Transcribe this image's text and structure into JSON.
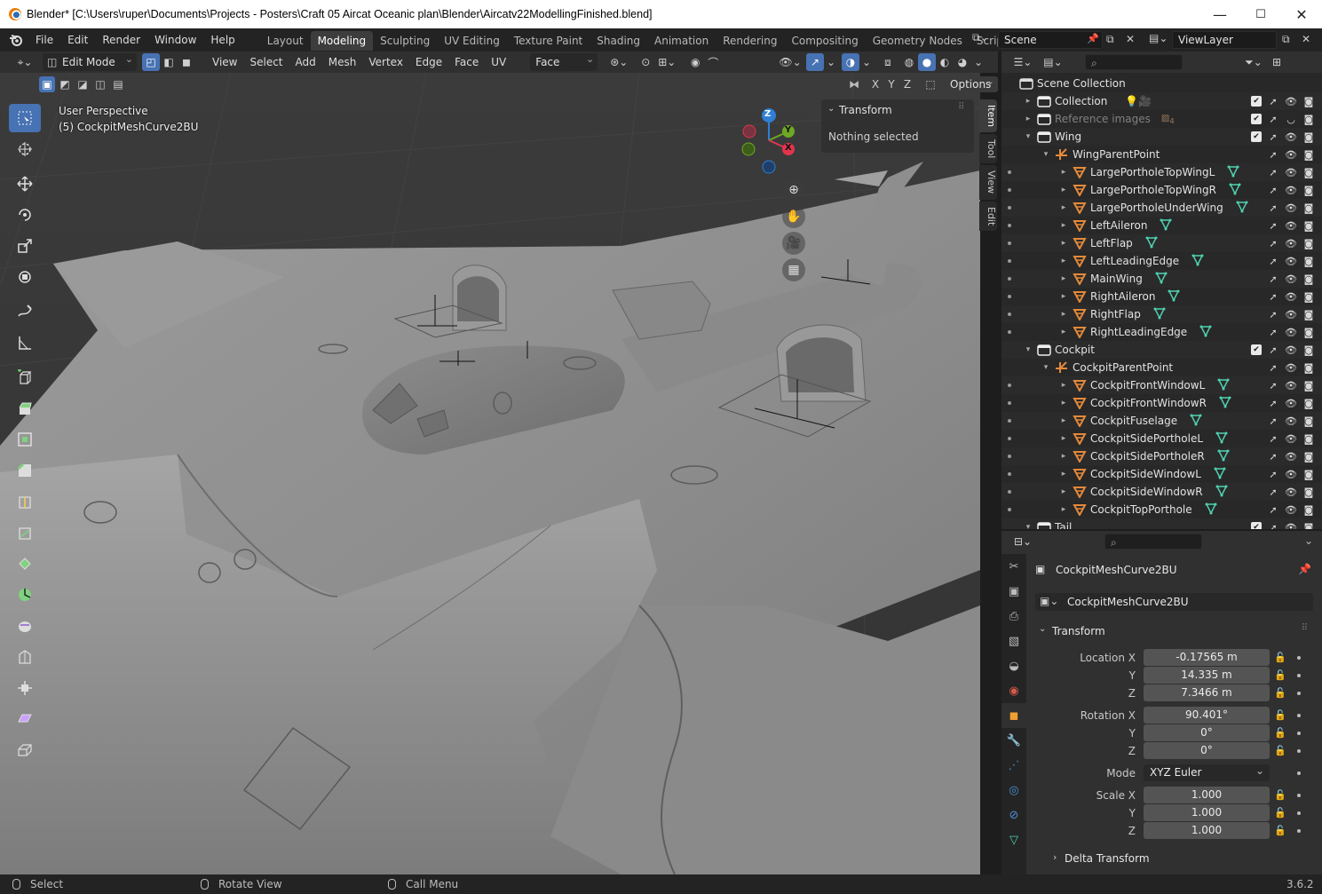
{
  "window": {
    "title": "Blender* [C:\\Users\\ruper\\Documents\\Projects - Posters\\Craft 05 Aircat Oceanic plan\\Blender\\Aircatv22ModellingFinished.blend]",
    "minimize": "—",
    "maximize": "☐",
    "close": "✕"
  },
  "menus": [
    "File",
    "Edit",
    "Render",
    "Window",
    "Help"
  ],
  "workspaces": [
    "Layout",
    "Modeling",
    "Sculpting",
    "UV Editing",
    "Texture Paint",
    "Shading",
    "Animation",
    "Rendering",
    "Compositing",
    "Geometry Nodes",
    "Scripting"
  ],
  "active_workspace": "Modeling",
  "add_workspace": "+",
  "scene": {
    "name": "Scene",
    "view_layer": "ViewLayer"
  },
  "editor_header": {
    "mode": "Edit Mode",
    "menus": [
      "View",
      "Select",
      "Add",
      "Mesh",
      "Vertex",
      "Edge",
      "Face",
      "UV"
    ],
    "transform_orientation": "Face",
    "options_label": "Options",
    "axis_labels": [
      "X",
      "Y",
      "Z"
    ]
  },
  "viewport": {
    "view_name": "User Perspective",
    "object_name": "(5) CockpitMeshCurve2BU",
    "gizmo_axes": {
      "z": "Z",
      "y": "Y",
      "x": "X"
    },
    "axis_colors": {
      "x": "#e0344c",
      "y": "#6ea824",
      "z": "#2f7fd4"
    }
  },
  "n_panel": {
    "tabs": [
      "Item",
      "Tool",
      "View",
      "Edit"
    ],
    "active_tab": "Item",
    "section": "Transform",
    "message": "Nothing selected"
  },
  "outliner": {
    "rows": [
      {
        "label": "Scene Collection",
        "type": "scene",
        "indent": 0,
        "expand": "",
        "dot": false
      },
      {
        "label": "Collection",
        "type": "collection",
        "indent": 1,
        "expand": "▸",
        "dot": false,
        "extra": "light-camera"
      },
      {
        "label": "Reference images",
        "type": "collection",
        "indent": 1,
        "expand": "▸",
        "dot": false,
        "dim": true,
        "extra": "images",
        "extra_count": "4"
      },
      {
        "label": "Wing",
        "type": "collection",
        "indent": 1,
        "expand": "▾",
        "dot": false
      },
      {
        "label": "WingParentPoint",
        "type": "empty",
        "indent": 2,
        "expand": "▾",
        "dot": false
      },
      {
        "label": "LargePortholeTopWingL",
        "type": "mesh",
        "indent": 3,
        "expand": "▸",
        "dot": true
      },
      {
        "label": "LargePortholeTopWingR",
        "type": "mesh",
        "indent": 3,
        "expand": "▸",
        "dot": true
      },
      {
        "label": "LargePortholeUnderWing",
        "type": "mesh",
        "indent": 3,
        "expand": "▸",
        "dot": true
      },
      {
        "label": "LeftAileron",
        "type": "mesh",
        "indent": 3,
        "expand": "▸",
        "dot": true
      },
      {
        "label": "LeftFlap",
        "type": "mesh",
        "indent": 3,
        "expand": "▸",
        "dot": true
      },
      {
        "label": "LeftLeadingEdge",
        "type": "mesh",
        "indent": 3,
        "expand": "▸",
        "dot": true
      },
      {
        "label": "MainWing",
        "type": "mesh",
        "indent": 3,
        "expand": "▸",
        "dot": true
      },
      {
        "label": "RightAileron",
        "type": "mesh",
        "indent": 3,
        "expand": "▸",
        "dot": true
      },
      {
        "label": "RightFlap",
        "type": "mesh",
        "indent": 3,
        "expand": "▸",
        "dot": true
      },
      {
        "label": "RightLeadingEdge",
        "type": "mesh",
        "indent": 3,
        "expand": "▸",
        "dot": true
      },
      {
        "label": "Cockpit",
        "type": "collection",
        "indent": 1,
        "expand": "▾",
        "dot": false
      },
      {
        "label": "CockpitParentPoint",
        "type": "empty",
        "indent": 2,
        "expand": "▾",
        "dot": false
      },
      {
        "label": "CockpitFrontWindowL",
        "type": "mesh",
        "indent": 3,
        "expand": "▸",
        "dot": true
      },
      {
        "label": "CockpitFrontWindowR",
        "type": "mesh",
        "indent": 3,
        "expand": "▸",
        "dot": true
      },
      {
        "label": "CockpitFuselage",
        "type": "mesh",
        "indent": 3,
        "expand": "▸",
        "dot": true
      },
      {
        "label": "CockpitSidePortholeL",
        "type": "mesh",
        "indent": 3,
        "expand": "▸",
        "dot": true
      },
      {
        "label": "CockpitSidePortholeR",
        "type": "mesh",
        "indent": 3,
        "expand": "▸",
        "dot": true
      },
      {
        "label": "CockpitSideWindowL",
        "type": "mesh",
        "indent": 3,
        "expand": "▸",
        "dot": true
      },
      {
        "label": "CockpitSideWindowR",
        "type": "mesh",
        "indent": 3,
        "expand": "▸",
        "dot": true
      },
      {
        "label": "CockpitTopPorthole",
        "type": "mesh",
        "indent": 3,
        "expand": "▸",
        "dot": true
      },
      {
        "label": "Tail",
        "type": "collection",
        "indent": 1,
        "expand": "▾",
        "dot": false
      }
    ]
  },
  "properties": {
    "object_name": "CockpitMeshCurve2BU",
    "datablock_name": "CockpitMeshCurve2BU",
    "section": "Transform",
    "location": {
      "label_x": "Location X",
      "x": "-0.17565 m",
      "y": "14.335 m",
      "z": "7.3466 m"
    },
    "rotation": {
      "label_x": "Rotation X",
      "x": "90.401°",
      "y": "0°",
      "z": "0°"
    },
    "mode_label": "Mode",
    "mode_value": "XYZ Euler",
    "scale": {
      "label_x": "Scale X",
      "x": "1.000",
      "y": "1.000",
      "z": "1.000"
    },
    "axis_y": "Y",
    "axis_z": "Z",
    "delta_section": "Delta Transform"
  },
  "statusbar": {
    "select": "Select",
    "rotate_view": "Rotate View",
    "call_menu": "Call Menu",
    "version": "3.6.2"
  },
  "colors": {
    "accent": "#4772b3",
    "mesh_icon": "#e4893a",
    "vertex_data": "#4fd1b0"
  }
}
